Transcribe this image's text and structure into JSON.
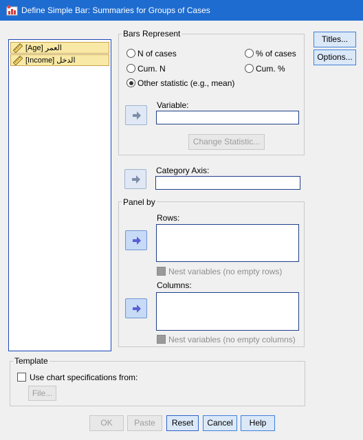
{
  "window": {
    "title": "Define Simple Bar: Summaries for Groups of Cases",
    "icon": "spss-chart-icon"
  },
  "variables": [
    {
      "label": "[Age] العمر",
      "icon": "ruler-icon"
    },
    {
      "label": "[Income] الدخل",
      "icon": "ruler-icon"
    }
  ],
  "bars_represent": {
    "title": "Bars Represent",
    "options": {
      "n_cases": "N of cases",
      "pct_cases": "% of cases",
      "cum_n": "Cum. N",
      "cum_pct": "Cum. %",
      "other": "Other statistic (e.g., mean)"
    },
    "selected": "Other statistic (e.g., mean)",
    "variable_label": "Variable:",
    "variable_value": "",
    "change_statistic": "Change Statistic..."
  },
  "category_axis": {
    "label": "Category Axis:",
    "value": ""
  },
  "panel_by": {
    "title": "Panel by",
    "rows_label": "Rows:",
    "nest_rows": "Nest variables (no empty rows)",
    "columns_label": "Columns:",
    "nest_columns": "Nest variables (no empty columns)"
  },
  "template": {
    "title": "Template",
    "use_spec": "Use chart specifications from:",
    "file_button": "File..."
  },
  "side_buttons": {
    "titles": "Titles...",
    "options": "Options..."
  },
  "bottom_buttons": {
    "ok": "OK",
    "paste": "Paste",
    "reset": "Reset",
    "cancel": "Cancel",
    "help": "Help"
  }
}
